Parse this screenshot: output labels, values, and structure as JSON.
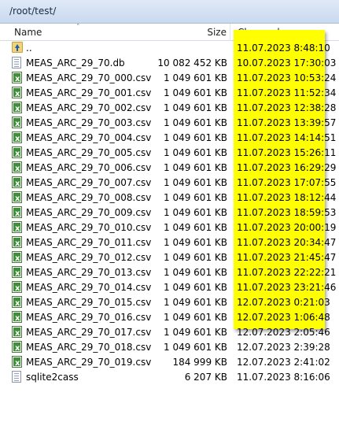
{
  "path": "/root/test/",
  "columns": {
    "name": "Name",
    "size": "Size",
    "changed": "Changed"
  },
  "files": [
    {
      "icon": "folder-up-icon",
      "name": "..",
      "size": "",
      "changed": "11.07.2023 8:48:10"
    },
    {
      "icon": "db-file-icon",
      "name": "MEAS_ARC_29_70.db",
      "size": "10 082 452 KB",
      "changed": "10.07.2023 17:30:03"
    },
    {
      "icon": "csv-file-icon",
      "name": "MEAS_ARC_29_70_000.csv",
      "size": "1 049 601 KB",
      "changed": "11.07.2023 10:53:24"
    },
    {
      "icon": "csv-file-icon",
      "name": "MEAS_ARC_29_70_001.csv",
      "size": "1 049 601 KB",
      "changed": "11.07.2023 11:52:34"
    },
    {
      "icon": "csv-file-icon",
      "name": "MEAS_ARC_29_70_002.csv",
      "size": "1 049 601 KB",
      "changed": "11.07.2023 12:38:28"
    },
    {
      "icon": "csv-file-icon",
      "name": "MEAS_ARC_29_70_003.csv",
      "size": "1 049 601 KB",
      "changed": "11.07.2023 13:39:57"
    },
    {
      "icon": "csv-file-icon",
      "name": "MEAS_ARC_29_70_004.csv",
      "size": "1 049 601 KB",
      "changed": "11.07.2023 14:14:51"
    },
    {
      "icon": "csv-file-icon",
      "name": "MEAS_ARC_29_70_005.csv",
      "size": "1 049 601 KB",
      "changed": "11.07.2023 15:26:11"
    },
    {
      "icon": "csv-file-icon",
      "name": "MEAS_ARC_29_70_006.csv",
      "size": "1 049 601 KB",
      "changed": "11.07.2023 16:29:29"
    },
    {
      "icon": "csv-file-icon",
      "name": "MEAS_ARC_29_70_007.csv",
      "size": "1 049 601 KB",
      "changed": "11.07.2023 17:07:55"
    },
    {
      "icon": "csv-file-icon",
      "name": "MEAS_ARC_29_70_008.csv",
      "size": "1 049 601 KB",
      "changed": "11.07.2023 18:12:44"
    },
    {
      "icon": "csv-file-icon",
      "name": "MEAS_ARC_29_70_009.csv",
      "size": "1 049 601 KB",
      "changed": "11.07.2023 18:59:53"
    },
    {
      "icon": "csv-file-icon",
      "name": "MEAS_ARC_29_70_010.csv",
      "size": "1 049 601 KB",
      "changed": "11.07.2023 20:00:19"
    },
    {
      "icon": "csv-file-icon",
      "name": "MEAS_ARC_29_70_011.csv",
      "size": "1 049 601 KB",
      "changed": "11.07.2023 20:34:47"
    },
    {
      "icon": "csv-file-icon",
      "name": "MEAS_ARC_29_70_012.csv",
      "size": "1 049 601 KB",
      "changed": "11.07.2023 21:45:47"
    },
    {
      "icon": "csv-file-icon",
      "name": "MEAS_ARC_29_70_013.csv",
      "size": "1 049 601 KB",
      "changed": "11.07.2023 22:22:21"
    },
    {
      "icon": "csv-file-icon",
      "name": "MEAS_ARC_29_70_014.csv",
      "size": "1 049 601 KB",
      "changed": "11.07.2023 23:21:46"
    },
    {
      "icon": "csv-file-icon",
      "name": "MEAS_ARC_29_70_015.csv",
      "size": "1 049 601 KB",
      "changed": "12.07.2023 0:21:03"
    },
    {
      "icon": "csv-file-icon",
      "name": "MEAS_ARC_29_70_016.csv",
      "size": "1 049 601 KB",
      "changed": "12.07.2023 1:06:48"
    },
    {
      "icon": "csv-file-icon",
      "name": "MEAS_ARC_29_70_017.csv",
      "size": "1 049 601 KB",
      "changed": "12.07.2023 2:05:46"
    },
    {
      "icon": "csv-file-icon",
      "name": "MEAS_ARC_29_70_018.csv",
      "size": "1 049 601 KB",
      "changed": "12.07.2023 2:39:28"
    },
    {
      "icon": "csv-file-icon",
      "name": "MEAS_ARC_29_70_019.csv",
      "size": "184 999 KB",
      "changed": "12.07.2023 2:41:02"
    },
    {
      "icon": "file-icon",
      "name": "sqlite2cass",
      "size": "6 207 KB",
      "changed": "11.07.2023 8:16:06"
    }
  ],
  "highlight_color": "#ffff00"
}
